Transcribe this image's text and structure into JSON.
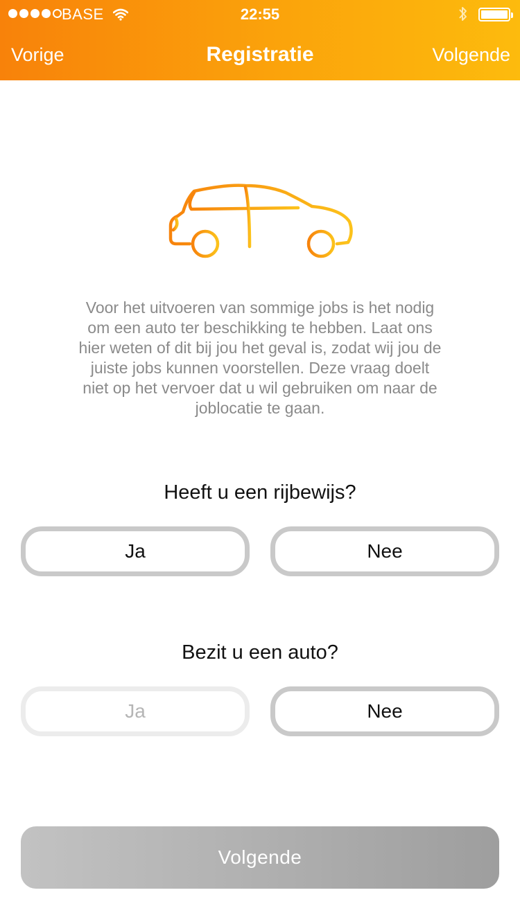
{
  "status_bar": {
    "carrier": "BASE",
    "time": "22:55",
    "signal_bars_filled": 4,
    "signal_bars_total": 5,
    "icons": [
      "wifi-icon",
      "bluetooth-icon",
      "battery-icon"
    ]
  },
  "nav": {
    "back_label": "Vorige",
    "title": "Registratie",
    "next_label": "Volgende"
  },
  "illustration": {
    "icon": "car-icon"
  },
  "description": "Voor het uitvoeren van sommige jobs is het nodig om een auto ter beschikking te hebben. Laat ons hier weten of dit bij jou het geval is, zodat wij jou de juiste jobs kunnen voorstellen. Deze vraag doelt niet op het vervoer dat u wil gebruiken om naar de joblocatie te gaan.",
  "questions": [
    {
      "label": "Heeft u een rijbewijs?",
      "yes_label": "Ja",
      "no_label": "Nee"
    },
    {
      "label": "Bezit u een auto?",
      "yes_label": "Ja",
      "no_label": "Nee"
    }
  ],
  "submit_label": "Volgende",
  "colors": {
    "header_gradient_start": "#f8820a",
    "header_gradient_end": "#fdbb0d",
    "choice_border": "#c9c9c9",
    "choice_border_disabled": "#ececec",
    "submit_gradient_start": "#c2c2c2",
    "submit_gradient_end": "#9e9e9e",
    "description_text": "#8a8a8a"
  }
}
